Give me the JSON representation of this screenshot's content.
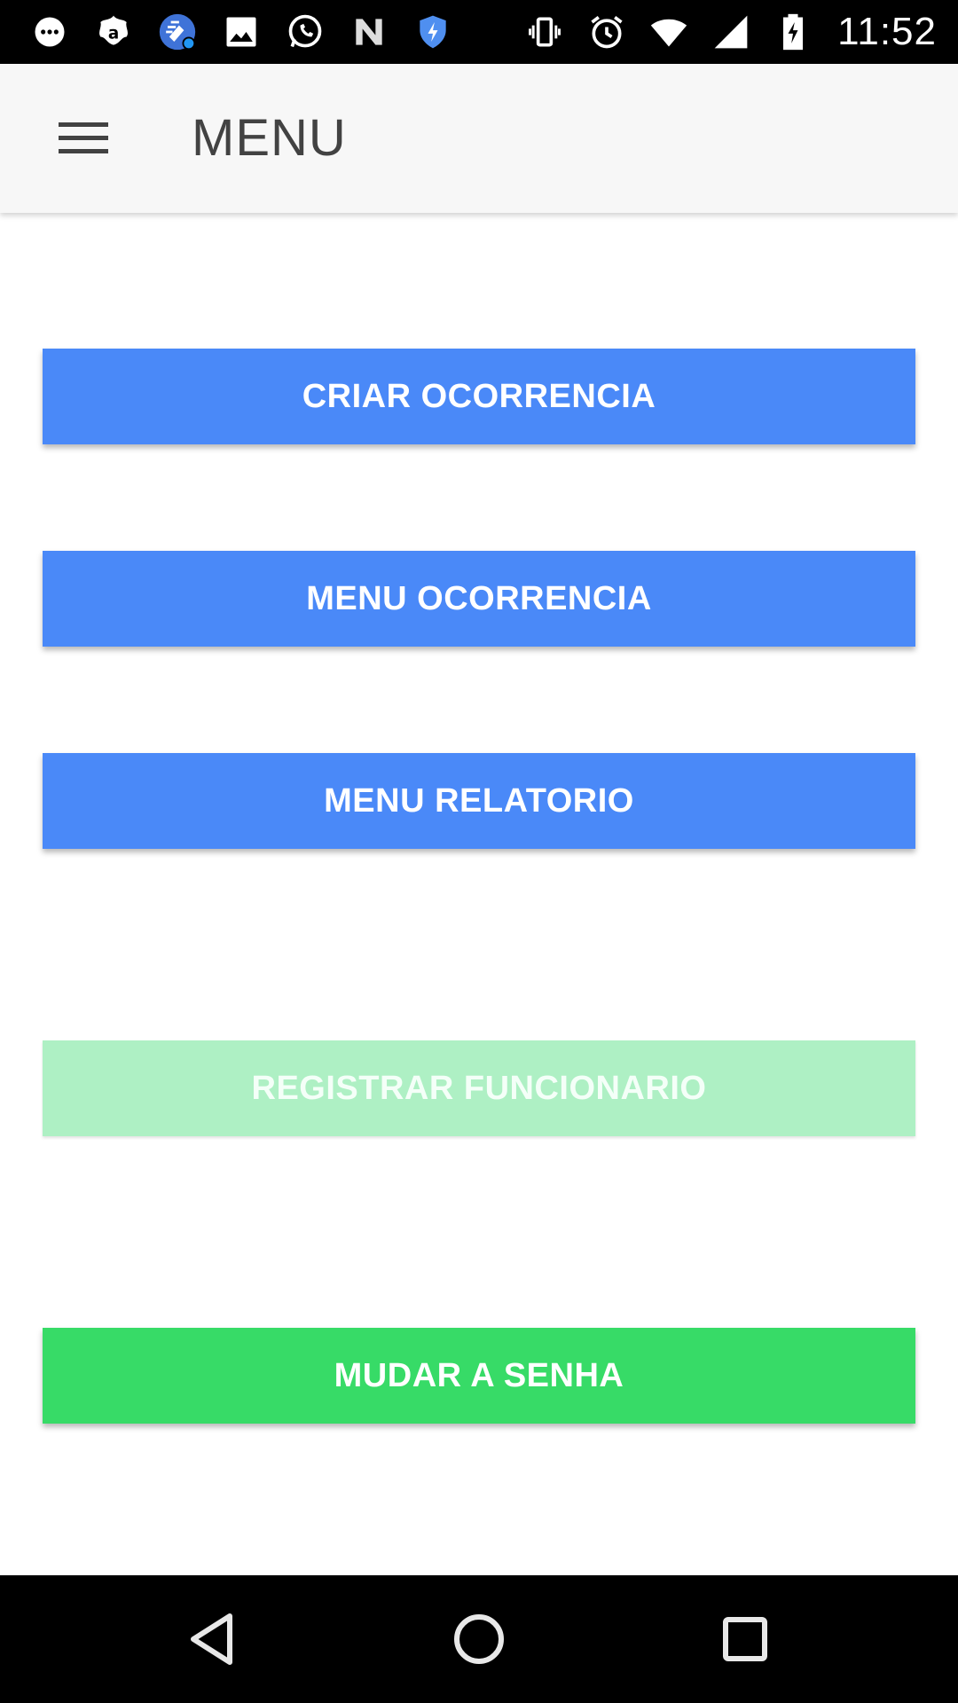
{
  "status_bar": {
    "time": "11:52",
    "notification_icons": [
      "messaging-icon",
      "avast-icon",
      "cleaner-icon",
      "gallery-icon",
      "whatsapp-icon",
      "n-app-icon",
      "shield-icon"
    ],
    "system_icons": [
      "vibrate-icon",
      "alarm-icon",
      "wifi-icon",
      "signal-icon",
      "battery-charging-icon"
    ]
  },
  "app_bar": {
    "title": "MENU",
    "menu_icon": "hamburger-menu-icon"
  },
  "buttons": {
    "criar_ocorrencia": "CRIAR OCORRENCIA",
    "menu_ocorrencia": "MENU OCORRENCIA",
    "menu_relatorio": "MENU RELATORIO",
    "registrar_funcionario": "REGISTRAR FUNCIONARIO",
    "mudar_senha": "MUDAR A SENHA"
  },
  "colors": {
    "primary_blue": "#4a89f8",
    "green": "#37db67",
    "green_disabled": "#aef0c4",
    "app_bar_bg": "#f7f7f7",
    "title_text": "#424242"
  },
  "nav_bar": {
    "icons": [
      "back-icon",
      "home-icon",
      "recents-icon"
    ]
  }
}
